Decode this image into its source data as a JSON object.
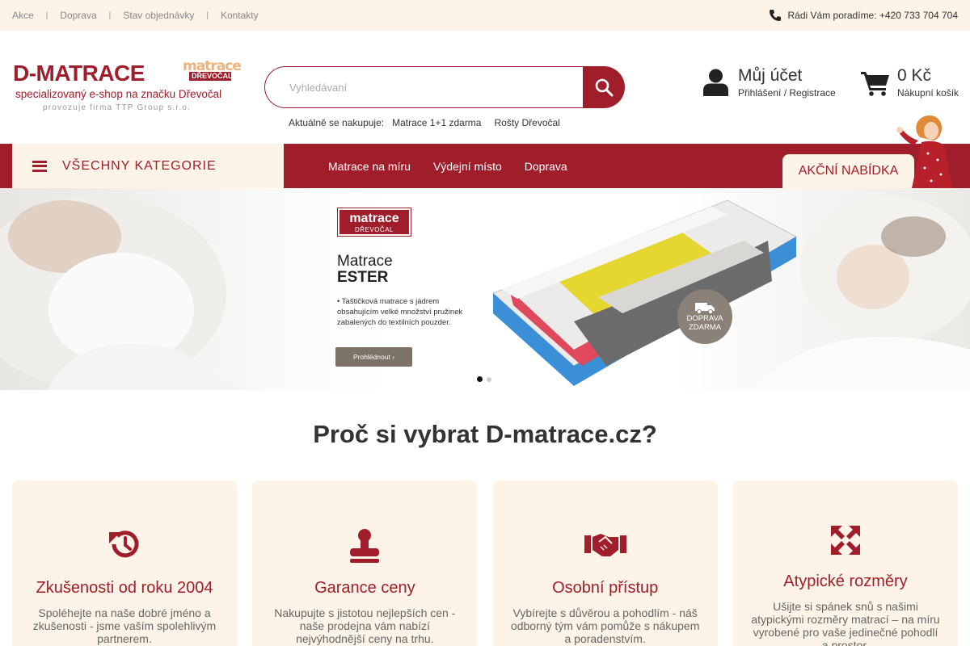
{
  "topbar": {
    "links": [
      "Akce",
      "Doprava",
      "Stav objednávky",
      "Kontakty"
    ],
    "separator": "|",
    "phone_text": "Rádi Vám poradíme: +420 733 704 704",
    "phone_icon": "phone-icon"
  },
  "logo": {
    "main": "D-MATRACE",
    "badge_top": "matrace",
    "badge_bottom": "DŘEVOČAL",
    "subtitle": "specializovaný e-shop na značku Dřevočal",
    "small": "provozuje firma TTP Group s.r.o."
  },
  "search": {
    "placeholder": "Vyhledávaní",
    "value": "",
    "icon": "search-icon"
  },
  "trending": {
    "label": "Aktuálně se nakupuje:",
    "items": [
      "Matrace 1+1 zdarma",
      "Rošty Dřevočal"
    ]
  },
  "account": {
    "title": "Můj účet",
    "subtitle": "Přihlášení / Registrace",
    "icon": "user-icon"
  },
  "cart": {
    "total": "0 Kč",
    "label": "Nákupní košík",
    "icon": "cart-icon"
  },
  "nav": {
    "all_categories": "VŠECHNY KATEGORIE",
    "items": [
      "Matrace na míru",
      "Výdejní místo",
      "Doprava"
    ],
    "promo": "AKČNÍ NABÍDKA"
  },
  "hero": {
    "brand_top": "matrace",
    "brand_bottom": "DŘEVOČAL",
    "heading_line1": "Matrace",
    "heading_line2": "ESTER",
    "description": "• Taštičková matrace s jádrem obsahujícím velké množství pružinek zabalených do textilních pouzder.",
    "button": "Prohlédnout ›",
    "badge_line1": "DOPRAVA",
    "badge_line2": "ZDARMA",
    "slides": 2,
    "active_slide": 1
  },
  "why": {
    "title": "Proč si vybrat D-matrace.cz?",
    "cards": [
      {
        "icon": "history-icon",
        "title": "Zkušenosti od roku 2004",
        "text": "Spoléhejte na naše dobré jméno a zkušenosti - jsme vaším spolehlivým partnerem."
      },
      {
        "icon": "stamp-icon",
        "title": "Garance ceny",
        "text": "Nakupujte s jistotou nejlepších cen - naše prodejna vám nabízí nejvýhodnější ceny na trhu."
      },
      {
        "icon": "handshake-icon",
        "title": "Osobní přístup",
        "text": "Vybírejte s důvěrou a pohodlím - náš odborný tým vám pomůže s nákupem a poradenstvím."
      },
      {
        "icon": "expand-icon",
        "title": "Atypické rozměry",
        "text": "Ušijte si spánek snů s našimi atypickými rozměry matrací – na míru vyrobené pro vaše jedinečné pohodlí a prostor."
      }
    ]
  },
  "colors": {
    "brand": "#a01e2c",
    "cream": "#fdf3e6"
  }
}
